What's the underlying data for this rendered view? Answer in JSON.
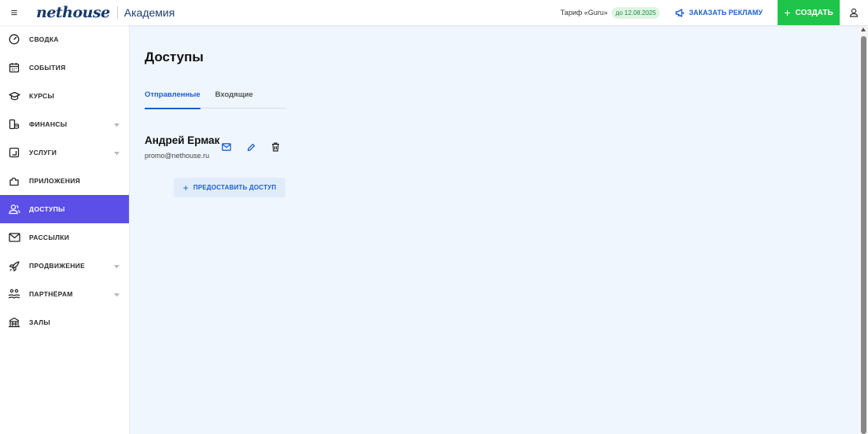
{
  "header": {
    "logo": "nethouse",
    "app_name": "Академия",
    "tariff": "Тариф «Guru»",
    "tariff_badge": "до 12.08.2025",
    "ad_label": "ЗАКАЗАТЬ РЕКЛАМУ",
    "create_label": "СОЗДАТЬ",
    "menu_icon": "burger-icon",
    "user_icon": "user-icon"
  },
  "sidebar": {
    "items": [
      {
        "label": "СВОДКА",
        "icon": "gauge-icon"
      },
      {
        "label": "СОБЫТИЯ",
        "icon": "calendar-icon"
      },
      {
        "label": "КУРСЫ",
        "icon": "graduation-cap-icon"
      },
      {
        "label": "ФИНАНСЫ",
        "icon": "coins-icon",
        "expandable": true
      },
      {
        "label": "УСЛУГИ",
        "icon": "services-icon",
        "expandable": true
      },
      {
        "label": "ПРИЛОЖЕНИЯ",
        "icon": "puzzle-icon"
      },
      {
        "label": "ДОСТУПЫ",
        "icon": "users-icon",
        "active": true
      },
      {
        "label": "РАССЫЛКИ",
        "icon": "mail-icon"
      },
      {
        "label": "ПРОДВИЖЕНИЕ",
        "icon": "rocket-icon",
        "expandable": true
      },
      {
        "label": "ПАРТНЁРАМ",
        "icon": "partners-icon",
        "expandable": true
      },
      {
        "label": "ЗАЛЫ",
        "icon": "hall-icon"
      }
    ]
  },
  "main": {
    "title": "Доступы",
    "tabs": [
      {
        "label": "Отправленные",
        "active": true
      },
      {
        "label": "Входящие",
        "active": false
      }
    ],
    "person": {
      "name": "Андрей Ермак",
      "email": "promo@nethouse.ru"
    },
    "grant_label": "ПРЕДОСТАВИТЬ ДОСТУП"
  },
  "colors": {
    "accent": "#1b5fcf",
    "active_nav": "#5b4fe8",
    "create_button": "#1fc44a",
    "background": "#f0f6fd"
  }
}
